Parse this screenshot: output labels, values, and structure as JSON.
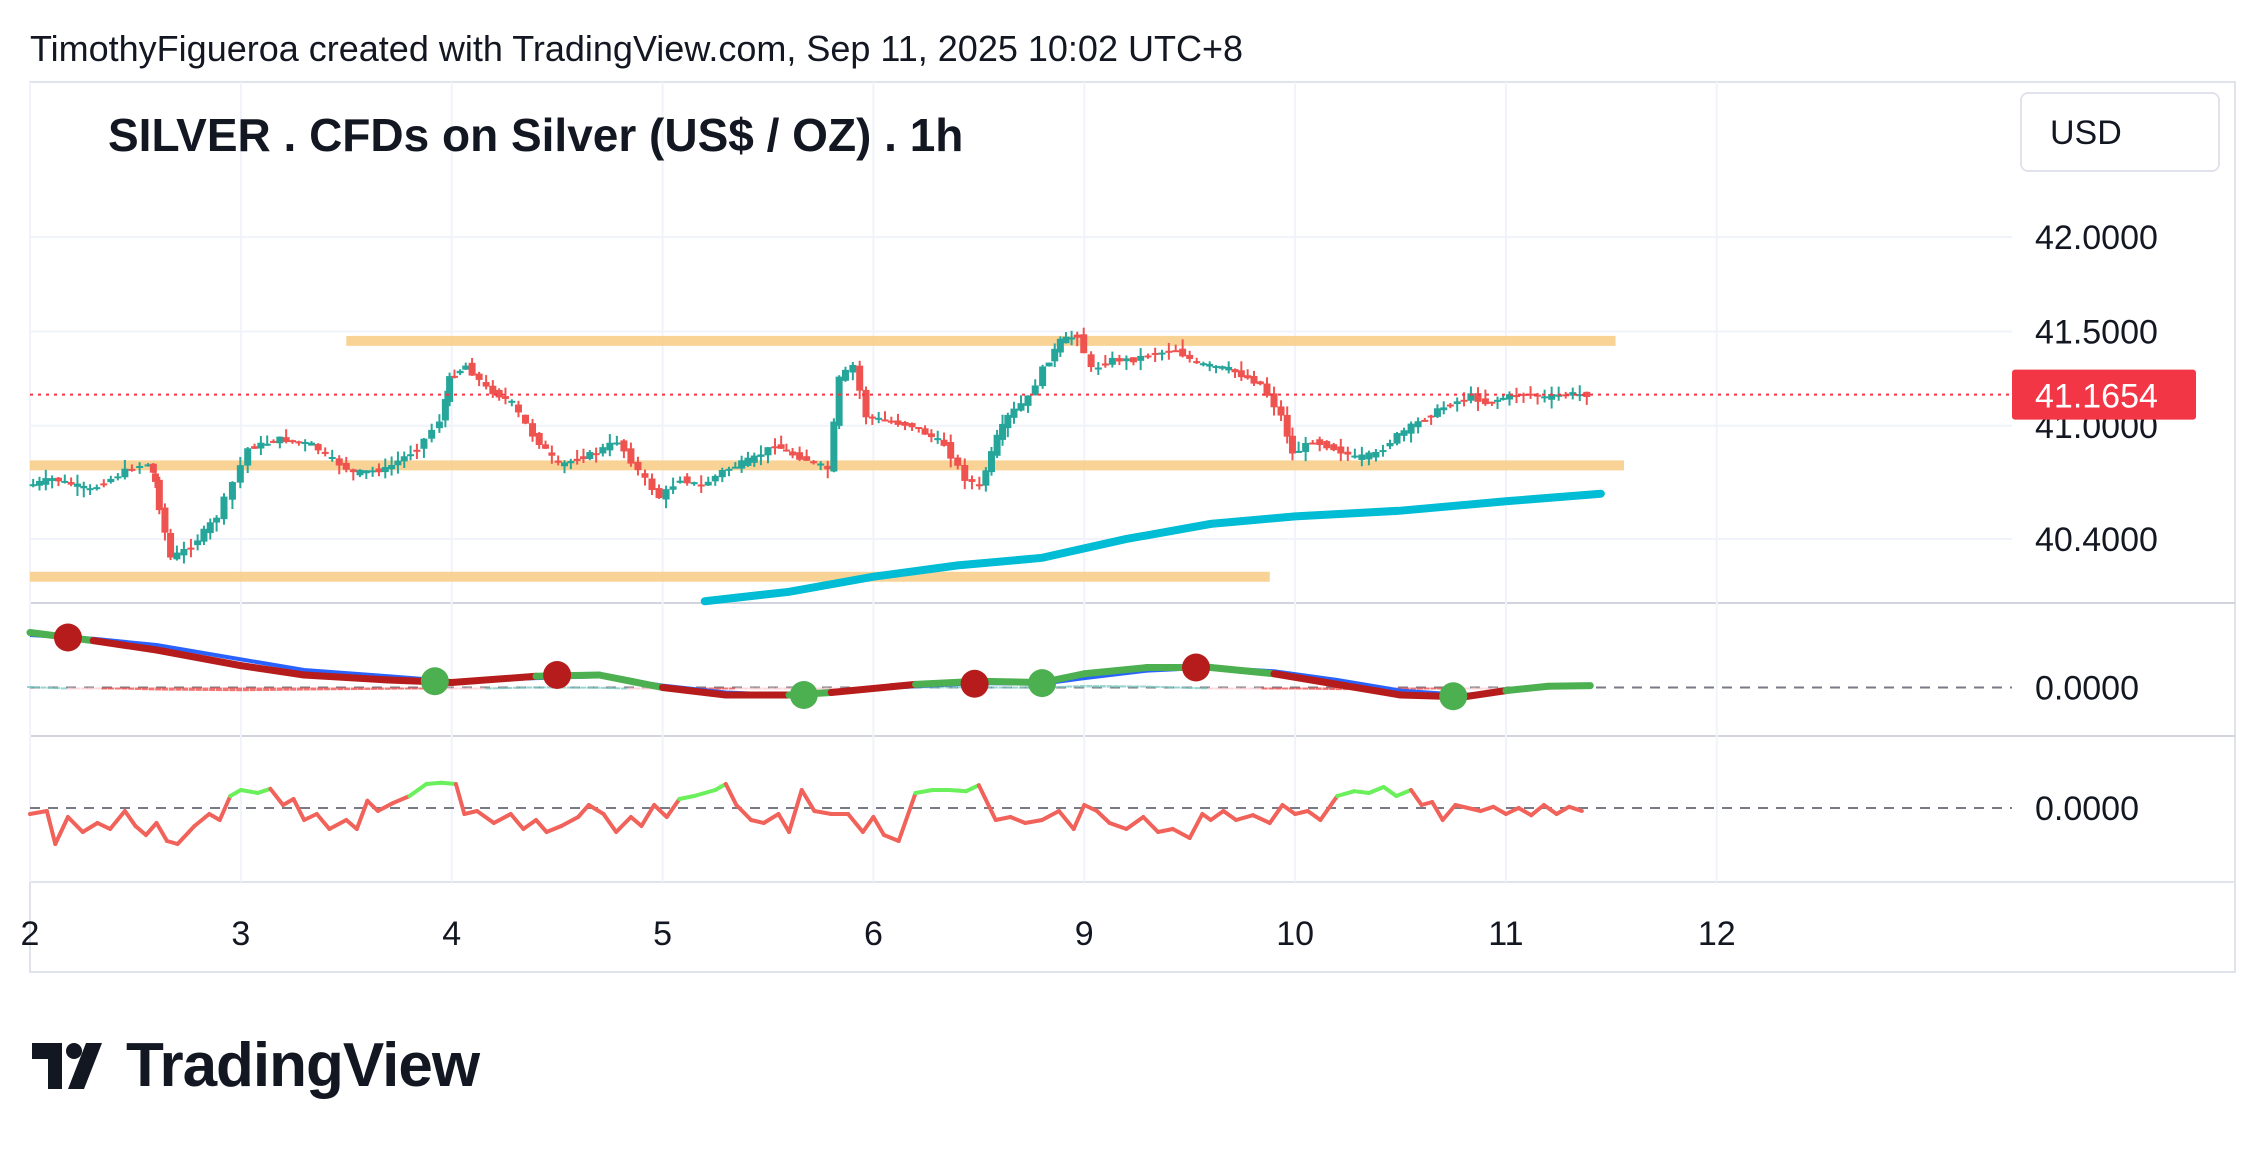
{
  "header": {
    "attribution": "TimothyFigueroa created with TradingView.com, Sep 11, 2025 10:02 UTC+8"
  },
  "brand": {
    "name": "TradingView",
    "logo_icon": "tradingview-logo-icon"
  },
  "chart_data": {
    "type": "candlestick",
    "title": "SILVER . CFDs on Silver (US$ / OZ) . 1h",
    "currency": "USD",
    "last_price": "41.1654",
    "price_axis_labels": [
      "42.0000",
      "41.5000",
      "41.0000",
      "40.4000"
    ],
    "price_axis_values": [
      42.0,
      41.5,
      41.0,
      40.4
    ],
    "ylim": [
      40.05,
      42.25
    ],
    "x_tick_labels": [
      "2",
      "3",
      "4",
      "5",
      "6",
      "9",
      "10",
      "11",
      "12"
    ],
    "x_tick_positions": [
      0,
      1,
      2,
      3,
      4,
      5,
      6,
      7,
      8
    ],
    "xlim": [
      0,
      9.4
    ],
    "horizontal_levels": [
      {
        "price": 41.45,
        "from": 1.5,
        "to": 7.52
      },
      {
        "price": 40.79,
        "from": 0,
        "to": 7.56
      },
      {
        "price": 40.2,
        "from": 0,
        "to": 5.88
      }
    ],
    "moving_average": {
      "color": "#00bcd4",
      "points": [
        [
          3.2,
          40.07
        ],
        [
          3.6,
          40.12
        ],
        [
          4.0,
          40.2
        ],
        [
          4.4,
          40.26
        ],
        [
          4.8,
          40.3
        ],
        [
          5.2,
          40.4
        ],
        [
          5.6,
          40.48
        ],
        [
          6.0,
          40.52
        ],
        [
          6.5,
          40.55
        ],
        [
          7.0,
          40.6
        ],
        [
          7.45,
          40.64
        ]
      ]
    },
    "series": [
      {
        "name": "price",
        "path": [
          [
            0,
            40.68
          ],
          [
            0.12,
            40.72
          ],
          [
            0.3,
            40.66
          ],
          [
            0.5,
            40.78
          ],
          [
            0.58,
            40.8
          ],
          [
            0.6,
            40.7
          ],
          [
            0.68,
            40.3
          ],
          [
            0.78,
            40.36
          ],
          [
            0.9,
            40.52
          ],
          [
            0.98,
            40.7
          ],
          [
            1.05,
            40.88
          ],
          [
            1.2,
            40.93
          ],
          [
            1.35,
            40.9
          ],
          [
            1.45,
            40.82
          ],
          [
            1.55,
            40.75
          ],
          [
            1.7,
            40.77
          ],
          [
            1.85,
            40.88
          ],
          [
            1.96,
            41.03
          ],
          [
            2.0,
            41.25
          ],
          [
            2.08,
            41.32
          ],
          [
            2.18,
            41.2
          ],
          [
            2.3,
            41.12
          ],
          [
            2.4,
            40.95
          ],
          [
            2.52,
            40.79
          ],
          [
            2.7,
            40.86
          ],
          [
            2.8,
            40.92
          ],
          [
            2.9,
            40.76
          ],
          [
            3.0,
            40.62
          ],
          [
            3.1,
            40.72
          ],
          [
            3.2,
            40.68
          ],
          [
            3.3,
            40.76
          ],
          [
            3.45,
            40.83
          ],
          [
            3.55,
            40.9
          ],
          [
            3.6,
            40.86
          ],
          [
            3.7,
            40.82
          ],
          [
            3.8,
            40.77
          ],
          [
            3.85,
            41.25
          ],
          [
            3.92,
            41.32
          ],
          [
            3.98,
            41.05
          ],
          [
            4.1,
            41.02
          ],
          [
            4.2,
            41.0
          ],
          [
            4.35,
            40.9
          ],
          [
            4.45,
            40.72
          ],
          [
            4.52,
            40.68
          ],
          [
            4.6,
            40.94
          ],
          [
            4.65,
            41.05
          ],
          [
            4.75,
            41.15
          ],
          [
            4.82,
            41.3
          ],
          [
            4.9,
            41.45
          ],
          [
            4.98,
            41.48
          ],
          [
            5.05,
            41.3
          ],
          [
            5.15,
            41.35
          ],
          [
            5.25,
            41.35
          ],
          [
            5.32,
            41.38
          ],
          [
            5.45,
            41.4
          ],
          [
            5.55,
            41.33
          ],
          [
            5.7,
            41.3
          ],
          [
            5.85,
            41.22
          ],
          [
            5.95,
            41.05
          ],
          [
            6.0,
            40.85
          ],
          [
            6.1,
            40.92
          ],
          [
            6.2,
            40.88
          ],
          [
            6.3,
            40.83
          ],
          [
            6.4,
            40.85
          ],
          [
            6.5,
            40.95
          ],
          [
            6.6,
            41.02
          ],
          [
            6.72,
            41.1
          ],
          [
            6.85,
            41.16
          ],
          [
            6.92,
            41.12
          ],
          [
            7.0,
            41.15
          ],
          [
            7.1,
            41.17
          ],
          [
            7.2,
            41.15
          ],
          [
            7.3,
            41.17
          ],
          [
            7.4,
            41.1654
          ]
        ]
      }
    ],
    "macd": {
      "zero_label": "0.0000",
      "ylim": [
        -0.6,
        1.0
      ],
      "fast_points": [
        [
          0,
          0.88
        ],
        [
          0.3,
          0.75
        ],
        [
          0.6,
          0.6
        ],
        [
          1.0,
          0.35
        ],
        [
          1.3,
          0.2
        ],
        [
          1.7,
          0.12
        ],
        [
          2.0,
          0.08
        ],
        [
          2.4,
          0.18
        ],
        [
          2.7,
          0.2
        ],
        [
          3.0,
          0.0
        ],
        [
          3.3,
          -0.12
        ],
        [
          3.6,
          -0.12
        ],
        [
          3.8,
          -0.08
        ],
        [
          4.2,
          0.05
        ],
        [
          4.5,
          0.1
        ],
        [
          4.8,
          0.08
        ],
        [
          5.0,
          0.22
        ],
        [
          5.3,
          0.32
        ],
        [
          5.6,
          0.32
        ],
        [
          5.9,
          0.22
        ],
        [
          6.2,
          0.05
        ],
        [
          6.5,
          -0.12
        ],
        [
          6.8,
          -0.15
        ],
        [
          7.0,
          -0.05
        ],
        [
          7.2,
          0.02
        ],
        [
          7.4,
          0.03
        ]
      ],
      "signal_points": [
        [
          0,
          0.84
        ],
        [
          0.3,
          0.78
        ],
        [
          0.6,
          0.68
        ],
        [
          1.0,
          0.45
        ],
        [
          1.3,
          0.28
        ],
        [
          1.7,
          0.18
        ],
        [
          2.0,
          0.1
        ],
        [
          2.4,
          0.15
        ],
        [
          2.7,
          0.18
        ],
        [
          3.0,
          0.03
        ],
        [
          3.3,
          -0.08
        ],
        [
          3.6,
          -0.12
        ],
        [
          3.8,
          -0.06
        ],
        [
          4.2,
          0.02
        ],
        [
          4.5,
          0.07
        ],
        [
          4.8,
          0.06
        ],
        [
          5.0,
          0.15
        ],
        [
          5.3,
          0.27
        ],
        [
          5.6,
          0.32
        ],
        [
          5.9,
          0.26
        ],
        [
          6.2,
          0.12
        ],
        [
          6.5,
          -0.05
        ],
        [
          6.8,
          -0.12
        ],
        [
          7.0,
          -0.06
        ],
        [
          7.2,
          0.0
        ],
        [
          7.4,
          0.02
        ]
      ],
      "cross_points": [
        {
          "x": 0.18,
          "y": 0.8,
          "kind": "bearish"
        },
        {
          "x": 1.92,
          "y": 0.1,
          "kind": "bullish"
        },
        {
          "x": 2.5,
          "y": 0.2,
          "kind": "bearish"
        },
        {
          "x": 3.67,
          "y": -0.12,
          "kind": "bullish"
        },
        {
          "x": 4.48,
          "y": 0.06,
          "kind": "bearish"
        },
        {
          "x": 4.8,
          "y": 0.07,
          "kind": "bullish"
        },
        {
          "x": 5.53,
          "y": 0.32,
          "kind": "bearish"
        },
        {
          "x": 6.75,
          "y": -0.14,
          "kind": "bullish"
        }
      ]
    },
    "oscillator": {
      "zero_label": "0.0000",
      "ylim": [
        -1.0,
        1.0
      ],
      "points": [
        [
          0,
          -0.1
        ],
        [
          0.08,
          -0.05
        ],
        [
          0.12,
          -0.6
        ],
        [
          0.18,
          -0.15
        ],
        [
          0.25,
          -0.4
        ],
        [
          0.32,
          -0.25
        ],
        [
          0.38,
          -0.35
        ],
        [
          0.45,
          -0.05
        ],
        [
          0.5,
          -0.3
        ],
        [
          0.55,
          -0.45
        ],
        [
          0.6,
          -0.25
        ],
        [
          0.65,
          -0.55
        ],
        [
          0.7,
          -0.6
        ],
        [
          0.78,
          -0.3
        ],
        [
          0.85,
          -0.1
        ],
        [
          0.9,
          -0.2
        ],
        [
          0.95,
          0.2
        ],
        [
          1.0,
          0.3
        ],
        [
          1.08,
          0.25
        ],
        [
          1.14,
          0.32
        ],
        [
          1.2,
          0.05
        ],
        [
          1.25,
          0.15
        ],
        [
          1.3,
          -0.2
        ],
        [
          1.36,
          -0.1
        ],
        [
          1.42,
          -0.35
        ],
        [
          1.5,
          -0.2
        ],
        [
          1.55,
          -0.35
        ],
        [
          1.6,
          0.12
        ],
        [
          1.65,
          -0.05
        ],
        [
          1.72,
          0.08
        ],
        [
          1.8,
          0.2
        ],
        [
          1.88,
          0.4
        ],
        [
          1.95,
          0.42
        ],
        [
          2.02,
          0.4
        ],
        [
          2.06,
          -0.1
        ],
        [
          2.12,
          -0.05
        ],
        [
          2.2,
          -0.25
        ],
        [
          2.28,
          -0.1
        ],
        [
          2.34,
          -0.35
        ],
        [
          2.4,
          -0.2
        ],
        [
          2.45,
          -0.4
        ],
        [
          2.52,
          -0.3
        ],
        [
          2.6,
          -0.15
        ],
        [
          2.65,
          0.05
        ],
        [
          2.72,
          -0.1
        ],
        [
          2.78,
          -0.4
        ],
        [
          2.85,
          -0.15
        ],
        [
          2.9,
          -0.3
        ],
        [
          2.96,
          0.05
        ],
        [
          3.02,
          -0.15
        ],
        [
          3.08,
          0.15
        ],
        [
          3.15,
          0.2
        ],
        [
          3.25,
          0.3
        ],
        [
          3.3,
          0.4
        ],
        [
          3.35,
          0.05
        ],
        [
          3.42,
          -0.2
        ],
        [
          3.48,
          -0.25
        ],
        [
          3.55,
          -0.1
        ],
        [
          3.6,
          -0.4
        ],
        [
          3.66,
          0.3
        ],
        [
          3.72,
          -0.05
        ],
        [
          3.8,
          -0.1
        ],
        [
          3.88,
          -0.1
        ],
        [
          3.95,
          -0.4
        ],
        [
          4.0,
          -0.15
        ],
        [
          4.05,
          -0.45
        ],
        [
          4.12,
          -0.55
        ],
        [
          4.2,
          0.25
        ],
        [
          4.28,
          0.3
        ],
        [
          4.36,
          0.3
        ],
        [
          4.44,
          0.28
        ],
        [
          4.5,
          0.38
        ],
        [
          4.58,
          -0.2
        ],
        [
          4.65,
          -0.15
        ],
        [
          4.72,
          -0.25
        ],
        [
          4.8,
          -0.2
        ],
        [
          4.88,
          -0.05
        ],
        [
          4.95,
          -0.35
        ],
        [
          5.0,
          0.05
        ],
        [
          5.06,
          -0.05
        ],
        [
          5.12,
          -0.25
        ],
        [
          5.2,
          -0.35
        ],
        [
          5.28,
          -0.15
        ],
        [
          5.35,
          -0.4
        ],
        [
          5.42,
          -0.35
        ],
        [
          5.5,
          -0.5
        ],
        [
          5.56,
          -0.1
        ],
        [
          5.6,
          -0.2
        ],
        [
          5.66,
          -0.05
        ],
        [
          5.72,
          -0.2
        ],
        [
          5.8,
          -0.12
        ],
        [
          5.88,
          -0.25
        ],
        [
          5.94,
          0.05
        ],
        [
          6.0,
          -0.1
        ],
        [
          6.06,
          -0.05
        ],
        [
          6.12,
          -0.2
        ],
        [
          6.2,
          0.2
        ],
        [
          6.28,
          0.28
        ],
        [
          6.35,
          0.25
        ],
        [
          6.42,
          0.35
        ],
        [
          6.48,
          0.2
        ],
        [
          6.55,
          0.3
        ],
        [
          6.6,
          0.05
        ],
        [
          6.65,
          0.1
        ],
        [
          6.7,
          -0.2
        ],
        [
          6.76,
          0.05
        ],
        [
          6.82,
          0.0
        ],
        [
          6.88,
          -0.05
        ],
        [
          6.94,
          0.02
        ],
        [
          7.0,
          -0.1
        ],
        [
          7.06,
          0.0
        ],
        [
          7.12,
          -0.12
        ],
        [
          7.18,
          0.05
        ],
        [
          7.24,
          -0.1
        ],
        [
          7.3,
          0.02
        ],
        [
          7.36,
          -0.05
        ]
      ]
    }
  }
}
